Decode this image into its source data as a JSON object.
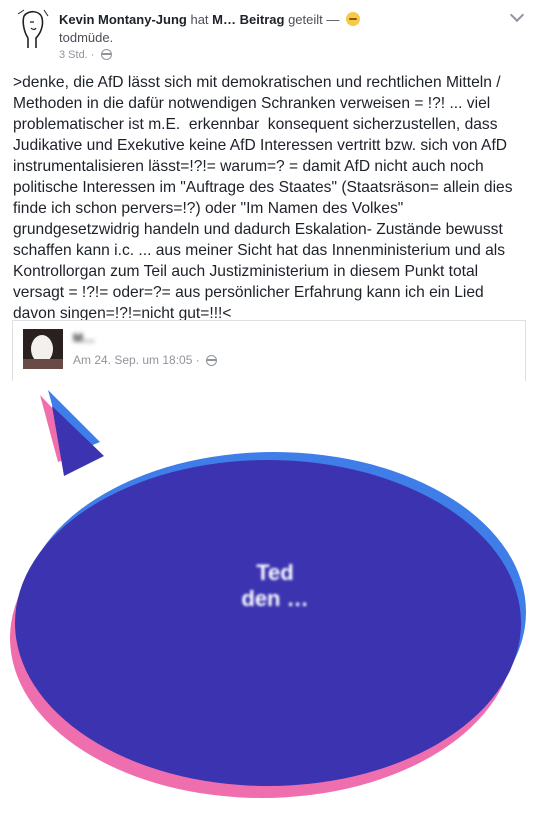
{
  "header": {
    "author": "Kevin Montany-Jung",
    "action_prefix": "hat",
    "shared_owner": "M…",
    "shared_post_word": "Beitrag",
    "action_suffix": "geteilt —",
    "feeling": "todmüde.",
    "time": "3 Std. ·",
    "privacy_icon": "globe-icon",
    "menu_icon": "chevron-down-icon"
  },
  "post": {
    "text": ">denke, die AfD lässt sich mit demokratischen und rechtlichen Mitteln / Methoden in die dafür notwendigen Schranken verweisen = !?! ... viel problematischer ist m.E.  erkennbar  konsequent sicherzustellen, dass Judikative und Exekutive keine AfD Interessen vertritt bzw. sich von AfD instrumentalisieren lässt=!?!= warum=? = damit AfD nicht auch noch politische Interessen im \"Auftrage des Staates\" (Staatsräson= allein dies finde ich schon pervers=!?) oder \"Im Namen des Volkes\" grundgesetzwidrig handeln und dadurch Eskalation- Zustände bewusst schaffen kann i.c. ... aus meiner Sicht hat das Innenministerium und als Kontrollorgan zum Teil auch Justizministerium in diesem Punkt total versagt = !?!= oder=?= aus persönlicher Erfahrung kann ich ein Lied davon singen=!?!=nicht gut=!!!<"
  },
  "shared": {
    "name": "M…",
    "date": "Am 24. Sep. um 18:05 ·",
    "image_text_line1": "Ted",
    "image_text_line2": "den …",
    "colors": {
      "bubble_fill": "#3b33b0",
      "bubble_pink": "#ef6fae",
      "bubble_light_blue": "#3f7ee8"
    }
  }
}
